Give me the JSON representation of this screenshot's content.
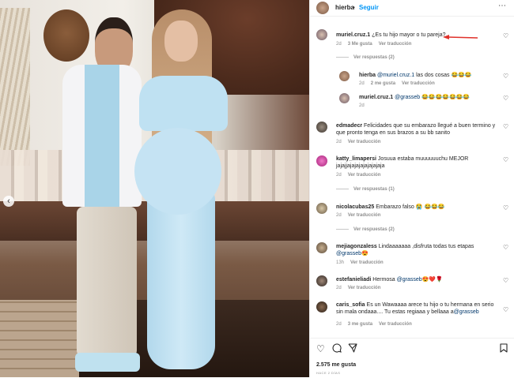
{
  "header": {
    "username": "hierba",
    "separator": "•",
    "follow_label": "Seguir",
    "more_icon": "more-horizontal-icon"
  },
  "comments": [
    {
      "username": "muriel.cruz.1",
      "text": " ¿Es tu hijo mayor o tu pareja?",
      "time": "2d",
      "likes": "3 Me gusta",
      "reply_label": "Ver traducción",
      "view_replies": "Ver respuestas (2)",
      "replies": [
        {
          "username": "hierba",
          "mention": "@muriel.cruz.1",
          "text": "las dos cosas",
          "emoji": "😂😂😂",
          "time": "2d",
          "likes": "2 me gusta",
          "translate": "Ver traducción"
        },
        {
          "username": "muriel.cruz.1",
          "mention": "@grasseb",
          "text": "",
          "emoji": "😂😂😂😂😂😂😂",
          "time": "2d"
        }
      ]
    },
    {
      "username": "edmadecr",
      "text": " Felicidades que su embarazo llegué a buen termino y que pronto tenga en sus brazos a su bb sanito",
      "time": "2d",
      "translate": "Ver traducción"
    },
    {
      "username": "katty_limapersi",
      "text": " Josuua estaba muuuuuuchu MEJOR jajajjajajajajajajajaja",
      "time": "2d",
      "translate": "Ver traducción",
      "view_replies": "Ver respuestas (1)"
    },
    {
      "username": "nicolacubas25",
      "text": " Embarazo falso ",
      "emoji": "😭 😂😂😂",
      "time": "2d",
      "translate": "Ver traducción",
      "view_replies": "Ver respuestas (2)"
    },
    {
      "username": "mejiagonzaless",
      "text": " Lindaaaaaaa ,disfruta todas tus etapas",
      "mention": "@grasseb",
      "emoji": "😍",
      "time": "13h",
      "translate": "Ver traducción"
    },
    {
      "username": "estefanieliadi",
      "text": " Hermosa",
      "mention": "@grasseb",
      "emoji": "😍❤️🌹",
      "time": "2d",
      "translate": "Ver traducción"
    },
    {
      "username": "caris_sofia",
      "text": " Es un Wawaaaa arece tu hijo o tu hermana en serio sin mala ondaaa.... Tu estas regiaaa y bellaaa a",
      "mention": "@grasseb",
      "time": "2d",
      "likes": "3 me gusta",
      "translate": "Ver traducción"
    }
  ],
  "actions": {
    "like_icon": "heart-icon",
    "comment_icon": "comment-icon",
    "share_icon": "share-icon",
    "save_icon": "bookmark-icon"
  },
  "likes_count": "2.575 me gusta",
  "date": "HACE 2 DÍAS",
  "colors": {
    "link": "#0095f6",
    "mention": "#00376b",
    "muted": "#8e8e8e",
    "annotation_arrow": "#e0312a"
  }
}
